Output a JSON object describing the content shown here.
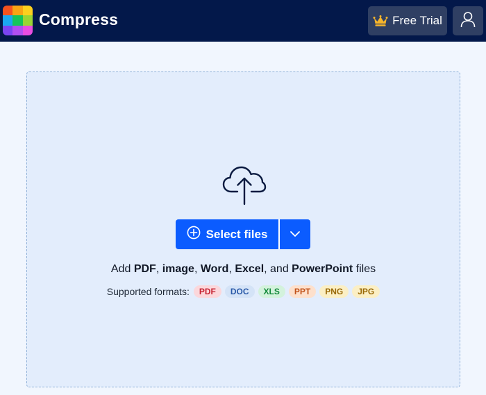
{
  "header": {
    "brand": "Compress",
    "trial_label": "Free Trial",
    "logo_colors": [
      "#f5521f",
      "#f7a414",
      "#fbd01e",
      "#1aa7f1",
      "#16c45a",
      "#9bd533",
      "#7a44f2",
      "#b04ff0",
      "#e84de1"
    ],
    "background": "#03184a"
  },
  "dropzone": {
    "select_label": "Select files",
    "add_text": {
      "prefix": "Add ",
      "pdf": "PDF",
      "sep1": ", ",
      "image": "image",
      "sep2": ", ",
      "word": "Word",
      "sep3": ", ",
      "excel": "Excel",
      "sep4": ", and ",
      "powerpoint": "PowerPoint",
      "suffix": " files"
    },
    "formats_label": "Supported formats:",
    "formats": [
      {
        "label": "PDF",
        "bg": "#fbd7db",
        "fg": "#c62231"
      },
      {
        "label": "DOC",
        "bg": "#d4e3f7",
        "fg": "#2a5aa8"
      },
      {
        "label": "XLS",
        "bg": "#d3f2dc",
        "fg": "#148a3b"
      },
      {
        "label": "PPT",
        "bg": "#fde0cc",
        "fg": "#c2531b"
      },
      {
        "label": "PNG",
        "bg": "#fbefc5",
        "fg": "#9a6a08"
      },
      {
        "label": "JPG",
        "bg": "#fbefc5",
        "fg": "#9a6a08"
      }
    ],
    "accent": "#0b5cff"
  },
  "icons": {
    "trial": "crown-icon",
    "account": "user-icon",
    "upload": "cloud-upload-icon",
    "select": "plus-circle-icon",
    "dropdown": "chevron-down-icon"
  }
}
